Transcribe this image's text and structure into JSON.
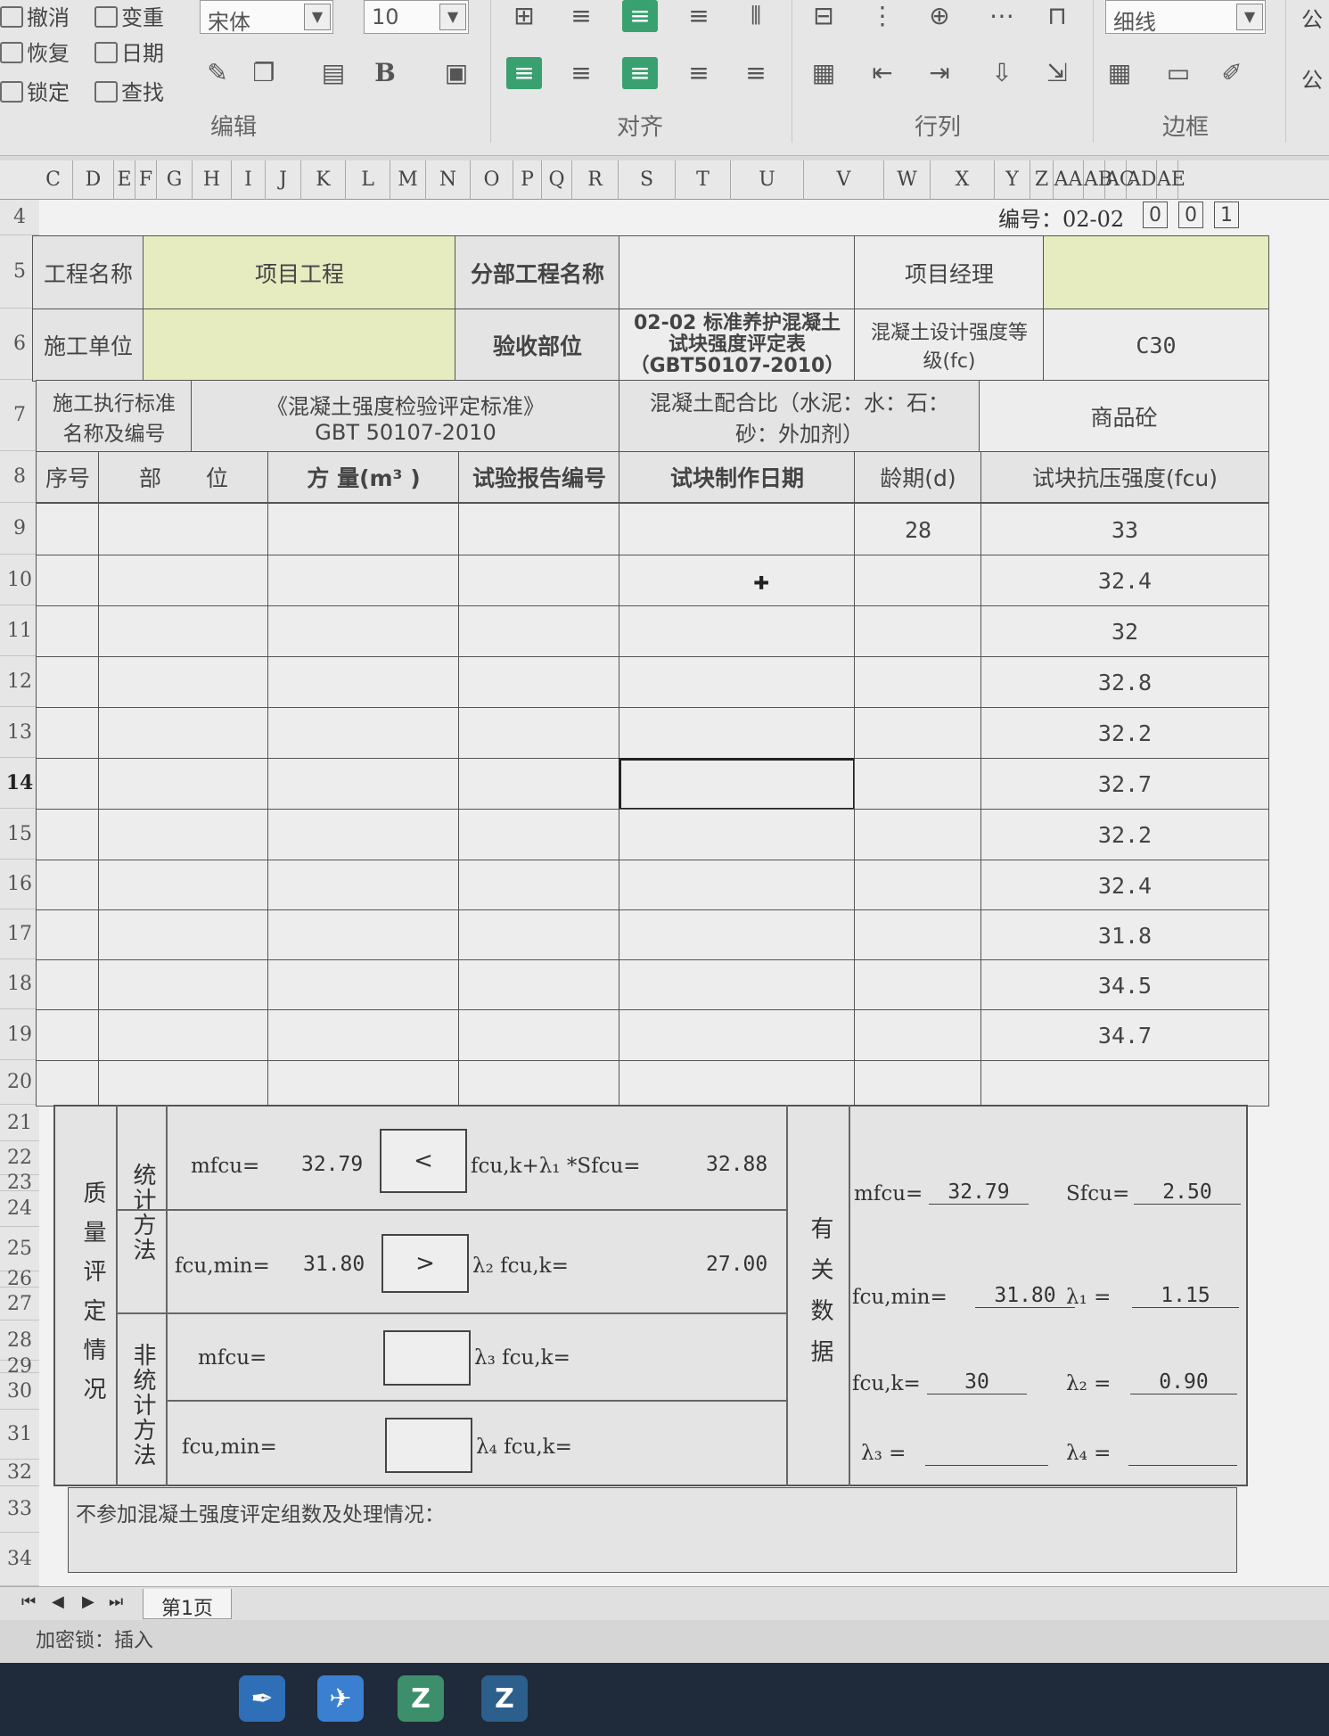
{
  "ribbon": {
    "undo": "撤消",
    "redo": "恢复",
    "lock": "锁定",
    "reset": "变重",
    "date": "日期",
    "find": "查找",
    "font_name": "宋体",
    "font_size": "10",
    "line_style": "细线",
    "group_edit": "编辑",
    "group_align": "对齐",
    "group_rowcol": "行列",
    "group_border": "边框",
    "group_formula": "公"
  },
  "columns": [
    "C",
    "D",
    "E",
    "F",
    "G",
    "H",
    "I",
    "J",
    "K",
    "L",
    "M",
    "N",
    "O",
    "P",
    "Q",
    "R",
    "S",
    "T",
    "U",
    "V",
    "W",
    "X",
    "Y",
    "Z",
    "AA",
    "AB",
    "AC",
    "AD",
    "AE"
  ],
  "rows": [
    "4",
    "5",
    "6",
    "7",
    "8",
    "9",
    "10",
    "11",
    "12",
    "13",
    "14",
    "15",
    "16",
    "17",
    "18",
    "19",
    "20",
    "21",
    "22",
    "23",
    "24",
    "25",
    "26",
    "27",
    "28",
    "29",
    "30",
    "31",
    "32",
    "33",
    "34"
  ],
  "header": {
    "code_label": "编号：02-02",
    "code_boxes": [
      "0",
      "0",
      "1"
    ],
    "project_name_label": "工程名称",
    "project_name_value": "项目工程",
    "sub_project_label": "分部工程名称",
    "sub_project_value": "",
    "pm_label": "项目经理",
    "pm_value": "",
    "contractor_label": "施工单位",
    "contractor_value": "",
    "acceptance_label": "验收部位",
    "form_title": "02-02 标准养护混凝土试块强度评定表（GBT50107-2010）",
    "grade_label": "混凝土设计强度等级(fc)",
    "grade_value": "C30",
    "standard_label": "施工执行标准名称及编号",
    "standard_value": "《混凝土强度检验评定标准》GBT 50107-2010",
    "mix_label": "混凝土配合比（水泥：水：石：砂：外加剂）",
    "mix_value": "商品砼"
  },
  "table": {
    "col_seq": "序号",
    "col_part": "部　　位",
    "col_volume": "方 量(m³ )",
    "col_report": "试验报告编号",
    "col_date": "试块制作日期",
    "col_age": "龄期(d)",
    "col_strength": "试块抗压强度(fcu)",
    "age_first": "28",
    "strengths": [
      "33",
      "32.4",
      "32",
      "32.8",
      "32.2",
      "32.7",
      "32.2",
      "32.4",
      "31.8",
      "34.5",
      "34.7",
      ""
    ]
  },
  "evaluation": {
    "section_label": "质量评定情况",
    "stat_label": "统计方法",
    "nonstat_label": "非统计方法",
    "mfcu_label": "mfcu=",
    "mfcu_value": "32.79",
    "cmp1": "<",
    "rhs1_label": "fcu,k+λ₁ *Sfcu=",
    "rhs1_value": "32.88",
    "fcumin_label": "fcu,min=",
    "fcumin_value": "31.80",
    "cmp2": ">",
    "rhs2_label": "λ₂ fcu,k=",
    "rhs2_value": "27.00",
    "mfcu3_label": "mfcu=",
    "rhs3_label": "λ₃ fcu,k=",
    "fcumin4_label": "fcu,min=",
    "rhs4_label": "λ₄ fcu,k=",
    "related_label": "有关数据",
    "rd_mfcu_label": "mfcu=",
    "rd_mfcu_value": "32.79",
    "rd_sfcu_label": "Sfcu=",
    "rd_sfcu_value": "2.50",
    "rd_fcumin_label": "fcu,min=",
    "rd_fcumin_value": "31.80",
    "rd_l1_label": "λ₁ =",
    "rd_l1_value": "1.15",
    "rd_fcuk_label": "fcu,k=",
    "rd_fcuk_value": "30",
    "rd_l2_label": "λ₂ =",
    "rd_l2_value": "0.90",
    "rd_l3_label": "λ₃ =",
    "rd_l4_label": "λ₄ =",
    "note_label": "不参加混凝土强度评定组数及处理情况："
  },
  "sheet_tab": "第1页",
  "status": "加密锁：插入",
  "taskbar_icons": [
    "feather-icon",
    "bird-icon",
    "zip-icon",
    "z-icon"
  ]
}
